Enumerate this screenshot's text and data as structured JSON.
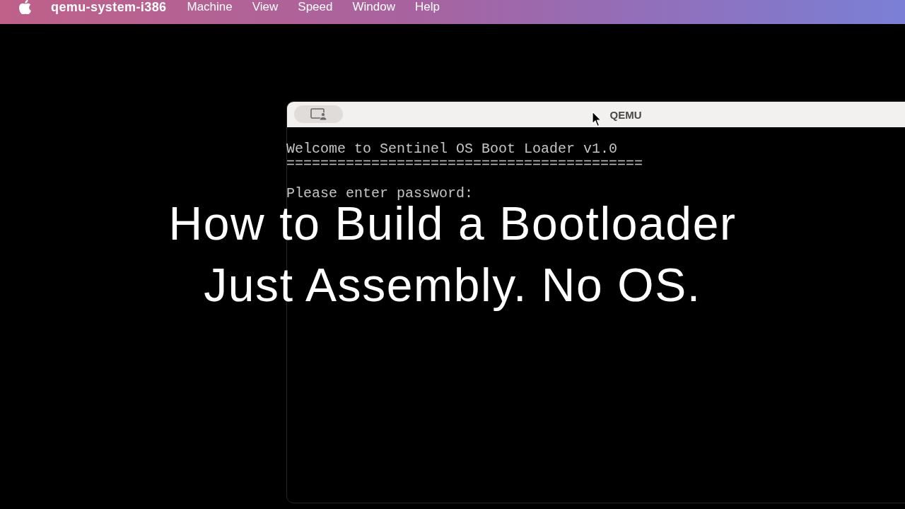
{
  "menu_bar": {
    "app_name": "qemu-system-i386",
    "items": [
      "Machine",
      "View",
      "Speed",
      "Window",
      "Help"
    ]
  },
  "window": {
    "title": "QEMU"
  },
  "console": {
    "blocks": [
      [
        "Welcome to Sentinel OS Boot Loader v1.0",
        "=========================================="
      ],
      [
        "Please enter password:"
      ]
    ]
  },
  "caption": {
    "lines": [
      "How to Build a Bootloader",
      "Just Assembly. No OS."
    ]
  }
}
